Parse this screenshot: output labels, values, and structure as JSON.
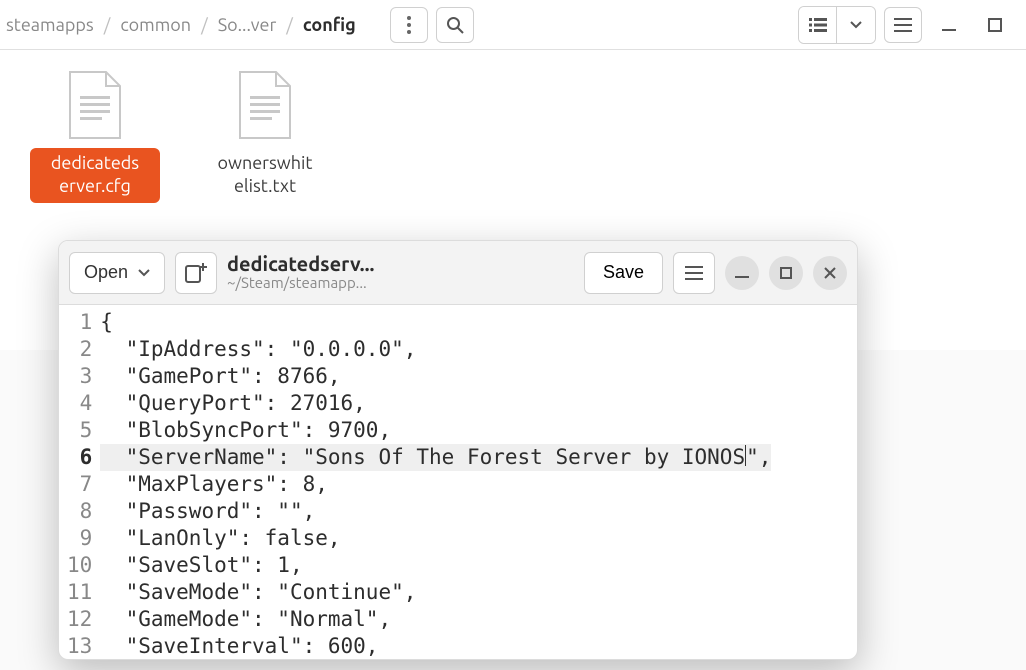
{
  "breadcrumb": [
    {
      "label": "steamapps",
      "current": false
    },
    {
      "label": "common",
      "current": false
    },
    {
      "label": "So...ver",
      "current": false
    },
    {
      "label": "config",
      "current": true
    }
  ],
  "files": [
    {
      "name": "dedicatedserver.cfg",
      "display": "dedicateds\nerver.cfg",
      "selected": true
    },
    {
      "name": "ownerswhitelist.txt",
      "display": "ownerswhit\nelist.txt",
      "selected": false
    }
  ],
  "editor": {
    "open_label": "Open",
    "save_label": "Save",
    "title": "dedicatedserv...",
    "subtitle": "~/Steam/steamapp...",
    "current_line": 6,
    "lines": [
      "{",
      "  \"IpAddress\": \"0.0.0.0\",",
      "  \"GamePort\": 8766,",
      "  \"QueryPort\": 27016,",
      "  \"BlobSyncPort\": 9700,",
      "  \"ServerName\": \"Sons Of The Forest Server by IONOS\",",
      "  \"MaxPlayers\": 8,",
      "  \"Password\": \"\",",
      "  \"LanOnly\": false,",
      "  \"SaveSlot\": 1,",
      "  \"SaveMode\": \"Continue\",",
      "  \"GameMode\": \"Normal\",",
      "  \"SaveInterval\": 600,"
    ],
    "caret_before": "  \"ServerName\": \"Sons Of The Forest Server by IONOS",
    "caret_after": "\","
  }
}
